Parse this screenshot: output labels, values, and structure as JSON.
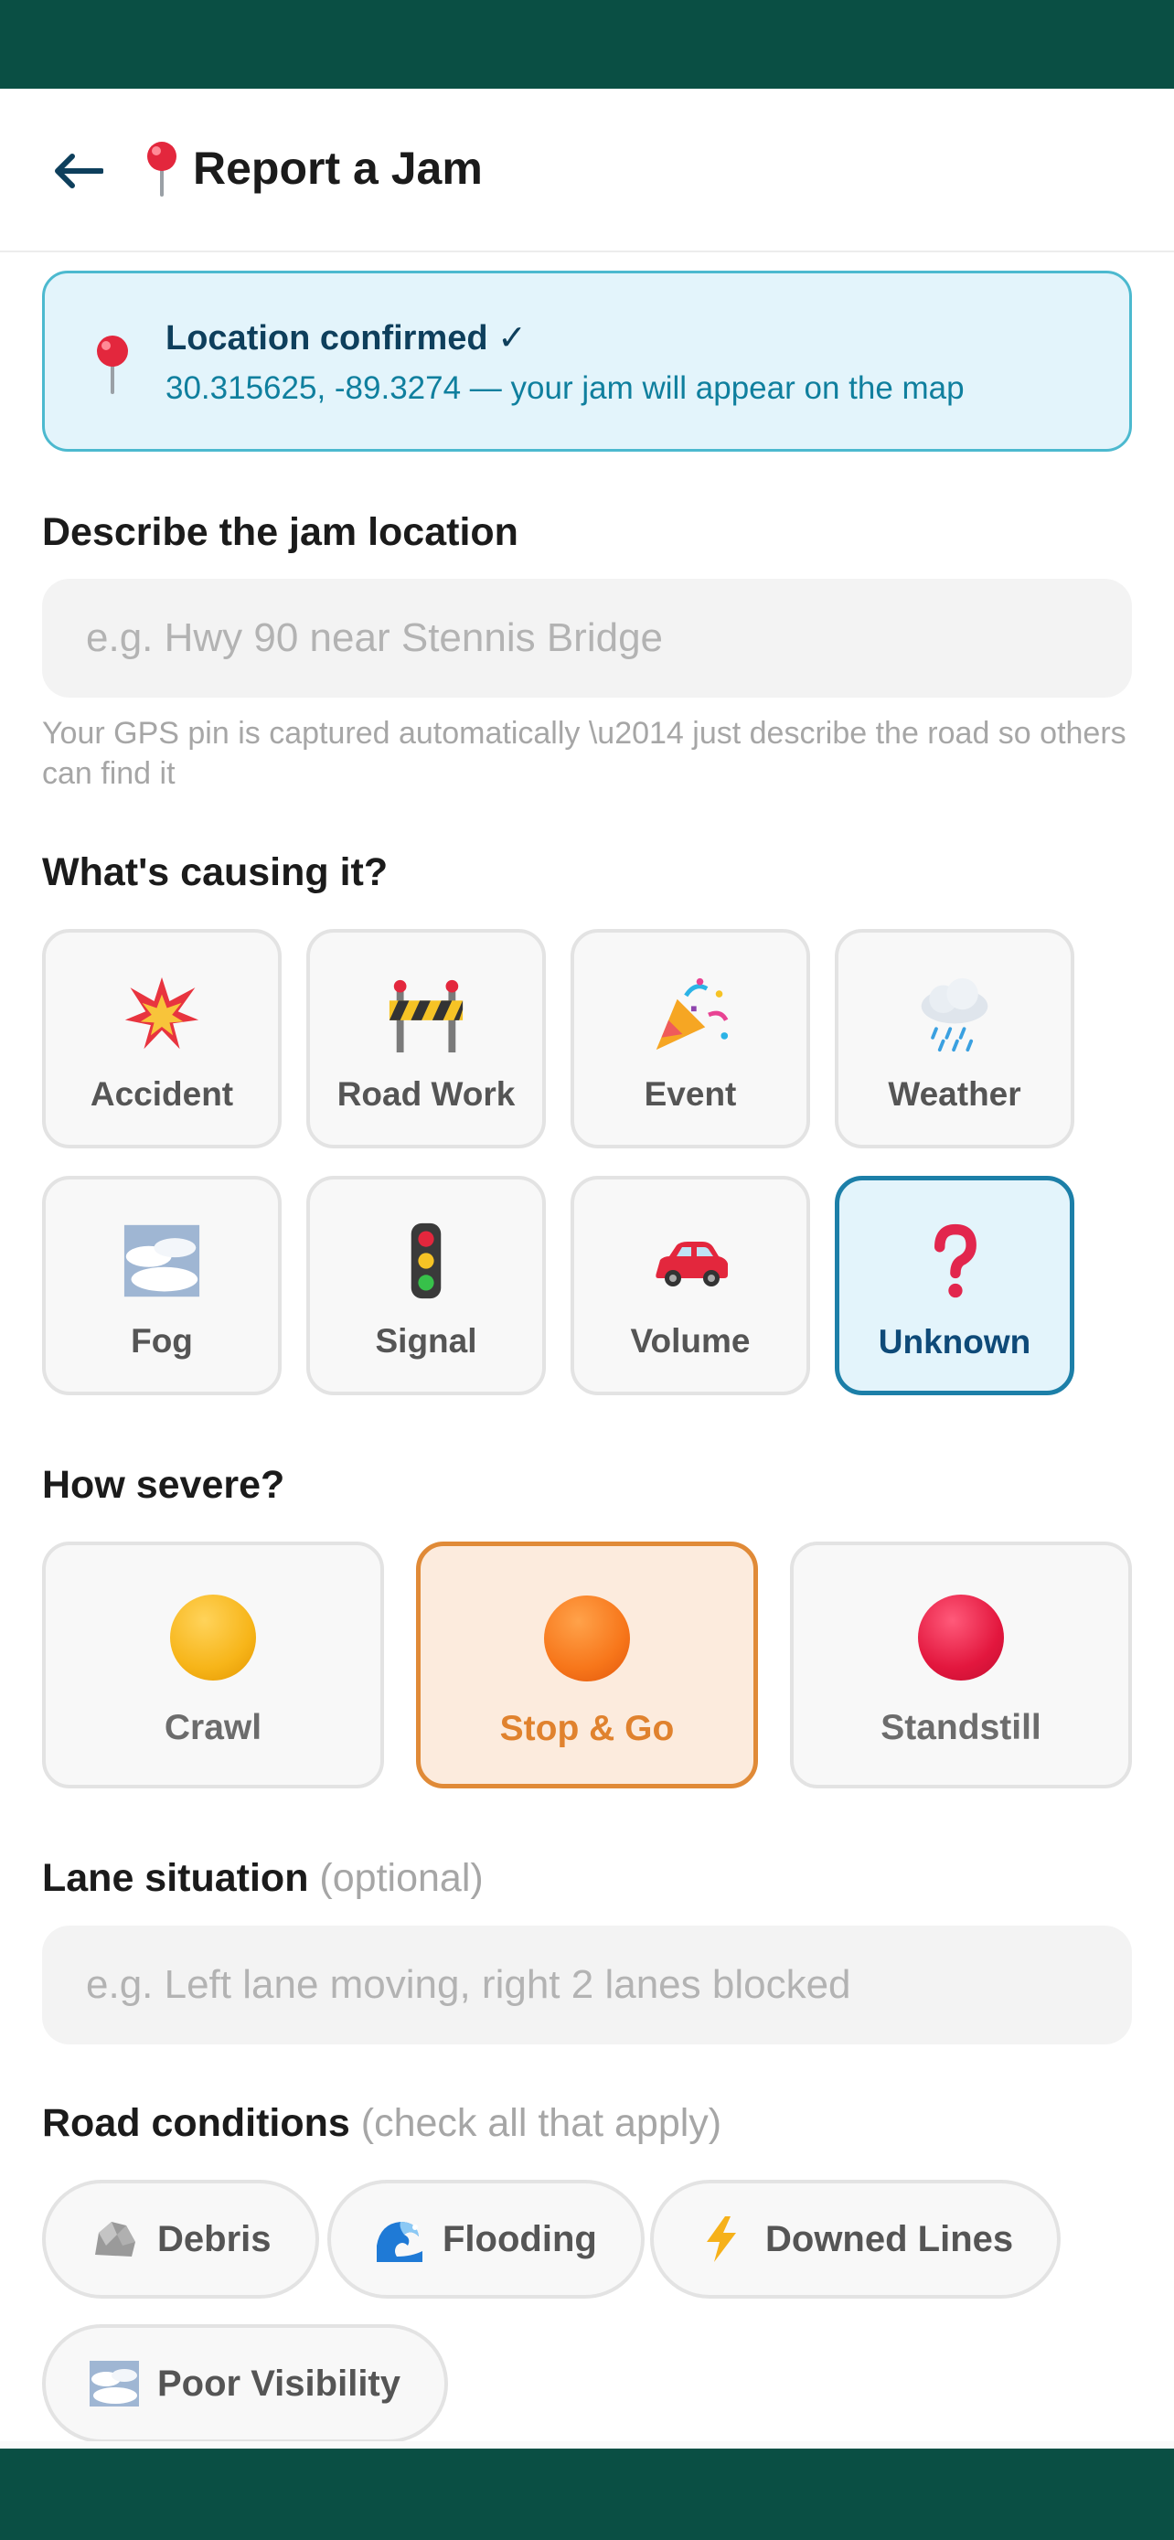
{
  "header": {
    "title": "Report a Jam"
  },
  "location": {
    "title": "Location confirmed ✓",
    "subtitle": "30.315625, -89.3274 — your jam will appear on the map"
  },
  "describe": {
    "label": "Describe the jam location",
    "placeholder": "e.g. Hwy 90 near Stennis Bridge",
    "helper": "Your GPS pin is captured automatically \\u2014 just describe the road so others can find it"
  },
  "cause": {
    "label": "What's causing it?",
    "options": [
      {
        "label": "Accident",
        "icon": "collision-icon",
        "selected": false
      },
      {
        "label": "Road Work",
        "icon": "construction-barrier-icon",
        "selected": false
      },
      {
        "label": "Event",
        "icon": "party-popper-icon",
        "selected": false
      },
      {
        "label": "Weather",
        "icon": "rain-cloud-icon",
        "selected": false
      },
      {
        "label": "Fog",
        "icon": "fog-icon",
        "selected": false
      },
      {
        "label": "Signal",
        "icon": "traffic-light-icon",
        "selected": false
      },
      {
        "label": "Volume",
        "icon": "car-icon",
        "selected": false
      },
      {
        "label": "Unknown",
        "icon": "question-mark-icon",
        "selected": true
      }
    ]
  },
  "severity": {
    "label": "How severe?",
    "options": [
      {
        "label": "Crawl",
        "color": "#f7b519",
        "selected": false
      },
      {
        "label": "Stop & Go",
        "color": "#f7761a",
        "selected": true
      },
      {
        "label": "Standstill",
        "color": "#e3173e",
        "selected": false
      }
    ]
  },
  "lanes": {
    "label": "Lane situation",
    "optional": "(optional)",
    "placeholder": "e.g. Left lane moving, right 2 lanes blocked"
  },
  "conditions": {
    "label": "Road conditions",
    "hint": "(check all that apply)",
    "chips": [
      {
        "label": "Debris",
        "icon": "rock-icon"
      },
      {
        "label": "Flooding",
        "icon": "wave-icon"
      },
      {
        "label": "Downed Lines",
        "icon": "lightning-icon"
      },
      {
        "label": "Poor Visibility",
        "icon": "fog-icon"
      }
    ]
  },
  "colors": {
    "status_bar": "#0a4f44",
    "accent_blue": "#1c7fa8",
    "accent_orange": "#e08a37"
  }
}
